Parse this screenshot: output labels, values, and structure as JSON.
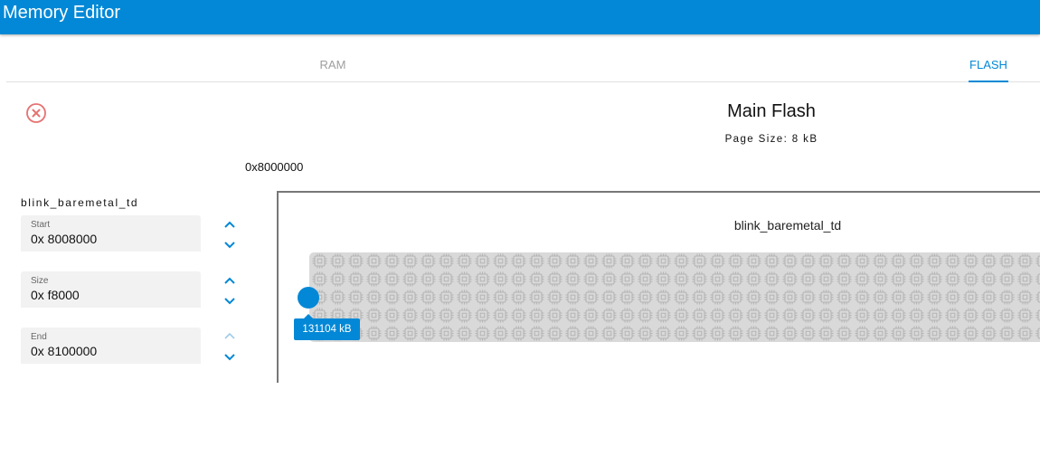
{
  "app": {
    "title": "Memory Editor"
  },
  "tabs": [
    {
      "label": "RAM",
      "active": false
    },
    {
      "label": "FLASH",
      "active": true
    }
  ],
  "flash": {
    "title": "Main Flash",
    "page_size": "Page Size: 8 kB",
    "base_address": "0x8000000"
  },
  "region": {
    "name": "blink_baremetal_td",
    "fields": {
      "start": {
        "label": "Start",
        "value": "0x 8008000"
      },
      "size": {
        "label": "Size",
        "value": "0x f8000"
      },
      "end": {
        "label": "End",
        "value": "0x 8100000"
      }
    },
    "block_label": "blink_baremetal_td",
    "slider_value": "131104 kB"
  },
  "colors": {
    "accent": "#0288d6",
    "close_icon": "#e57373",
    "block_fill": "#d9d9d9",
    "chip_pattern": "#b4b4b4"
  },
  "icons": {
    "close": "close-circle-icon",
    "increment": "chevron-up-icon",
    "decrement": "chevron-down-icon",
    "block_pattern": "memory-chip-icon"
  }
}
